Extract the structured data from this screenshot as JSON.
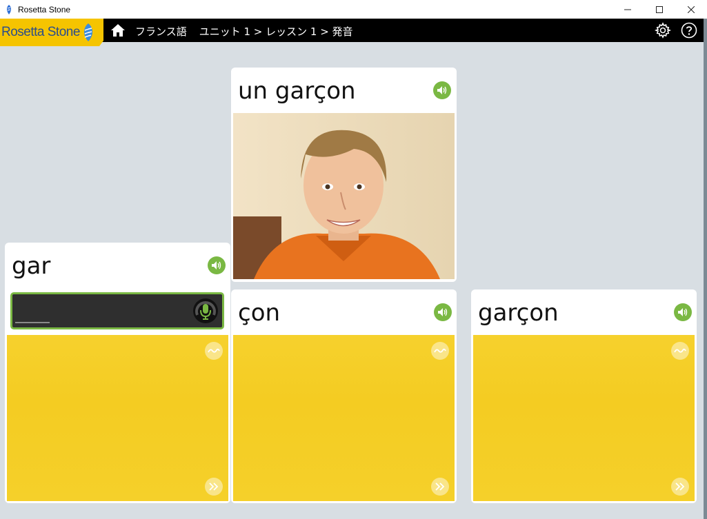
{
  "window": {
    "title": "Rosetta Stone"
  },
  "app": {
    "logo_text": "Rosetta Stone"
  },
  "breadcrumb": {
    "course": "フランス語",
    "path": "ユニット 1 > レッスン 1 > 発音"
  },
  "cards": {
    "main": {
      "word": "un garçon"
    },
    "gar": {
      "word": "gar"
    },
    "con": {
      "word": "çon"
    },
    "garcon": {
      "word": "garçon"
    }
  },
  "colors": {
    "accent_green": "#7ab843",
    "header_black": "#000000",
    "logo_yellow": "#f5c400",
    "panel_yellow": "#f5d02a"
  },
  "icons": [
    "home-icon",
    "gear-icon",
    "help-icon",
    "speaker-icon",
    "microphone-icon",
    "waveform-icon",
    "fast-forward-icon"
  ]
}
